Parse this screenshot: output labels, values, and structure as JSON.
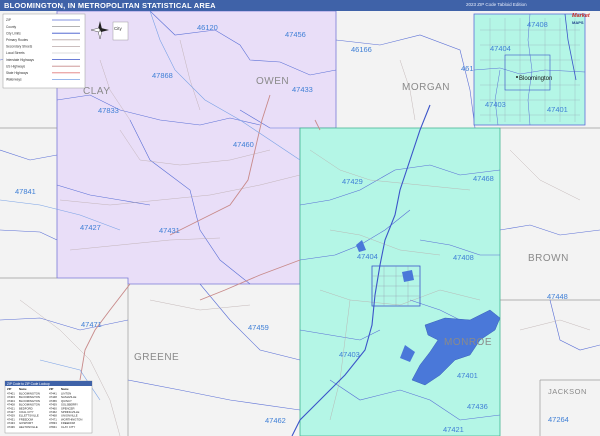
{
  "title": "BLOOMINGTON, IN METROPOLITAN STATISTICAL AREA",
  "edition": "2023 ZIP Code Tabloid Edition",
  "colors": {
    "title_bar": "#3f62a8",
    "owen_fill": "#e9def8",
    "monroe_fill": "#b4f6e6",
    "inset_fill": "#b4f6e6",
    "background": "#f3f3f3",
    "zip_line": "#5a6fd6",
    "county_line": "#9a9a9a",
    "zip_label": "#3f7fd6",
    "water": "#4a78d9",
    "highway": "#3b54c9",
    "us_route": "#c88a8a",
    "table_header": "#3f62a8"
  },
  "counties": {
    "clay": "CLAY",
    "owen": "OWEN",
    "morgan": "MORGAN",
    "brown": "BROWN",
    "greene": "GREENE",
    "monroe": "MONROE",
    "jackson": "JACKSON"
  },
  "zips": {
    "z46120": "46120",
    "z47456": "47456",
    "z46166": "46166",
    "z461": "461",
    "z47868": "47868",
    "z47433": "47433",
    "z47833": "47833",
    "z47460": "47460",
    "z47429": "47429",
    "z47468": "47468",
    "z47841": "47841",
    "z47427": "47427",
    "z47431": "47431",
    "z47404": "47404",
    "z47408": "47408",
    "z47448": "47448",
    "z47471": "47471",
    "z47459": "47459",
    "z47403": "47403",
    "z47401": "47401",
    "z47436": "47436",
    "z47462": "47462",
    "z47421": "47421",
    "z47264": "47264"
  },
  "inset": {
    "city": "Bloomington",
    "zips": {
      "z47408": "47408",
      "z47404": "47404",
      "z47403": "47403",
      "z47401": "47401"
    }
  },
  "legend": {
    "scale_label": "City",
    "rows": [
      "ZIP",
      "County",
      "City Limits",
      "Primary Routes",
      "Secondary Streets",
      "Local Streets",
      "Interstate Highways",
      "US Highways",
      "State Highways",
      "Waterways"
    ]
  },
  "zip_table": {
    "title": "ZIP Code to ZIP Code Lookup",
    "columns": [
      "ZIP",
      "Name",
      "ZIP",
      "Name"
    ],
    "rows": [
      [
        "47401",
        "BLOOMINGTON",
        "47441",
        "LINTON"
      ],
      [
        "47403",
        "BLOOMINGTON",
        "47448",
        "NASHVILLE"
      ],
      [
        "47404",
        "BLOOMINGTON",
        "47456",
        "QUINCY"
      ],
      [
        "47408",
        "BLOOMINGTON",
        "47459",
        "SOLSBERRY"
      ],
      [
        "47421",
        "BEDFORD",
        "47460",
        "SPENCER"
      ],
      [
        "47427",
        "COAL CITY",
        "47462",
        "SPRINGVILLE"
      ],
      [
        "47429",
        "ELLETTSVILLE",
        "47468",
        "UNIONVILLE"
      ],
      [
        "47431",
        "FREEDOM",
        "47471",
        "WORTHINGTON"
      ],
      [
        "47433",
        "GOSPORT",
        "47833",
        "FREEDOM"
      ],
      [
        "47436",
        "HELTONVILLE",
        "47841",
        "CLAY CITY"
      ]
    ]
  },
  "logo": {
    "line1": "Market",
    "line2": "MAPS"
  }
}
